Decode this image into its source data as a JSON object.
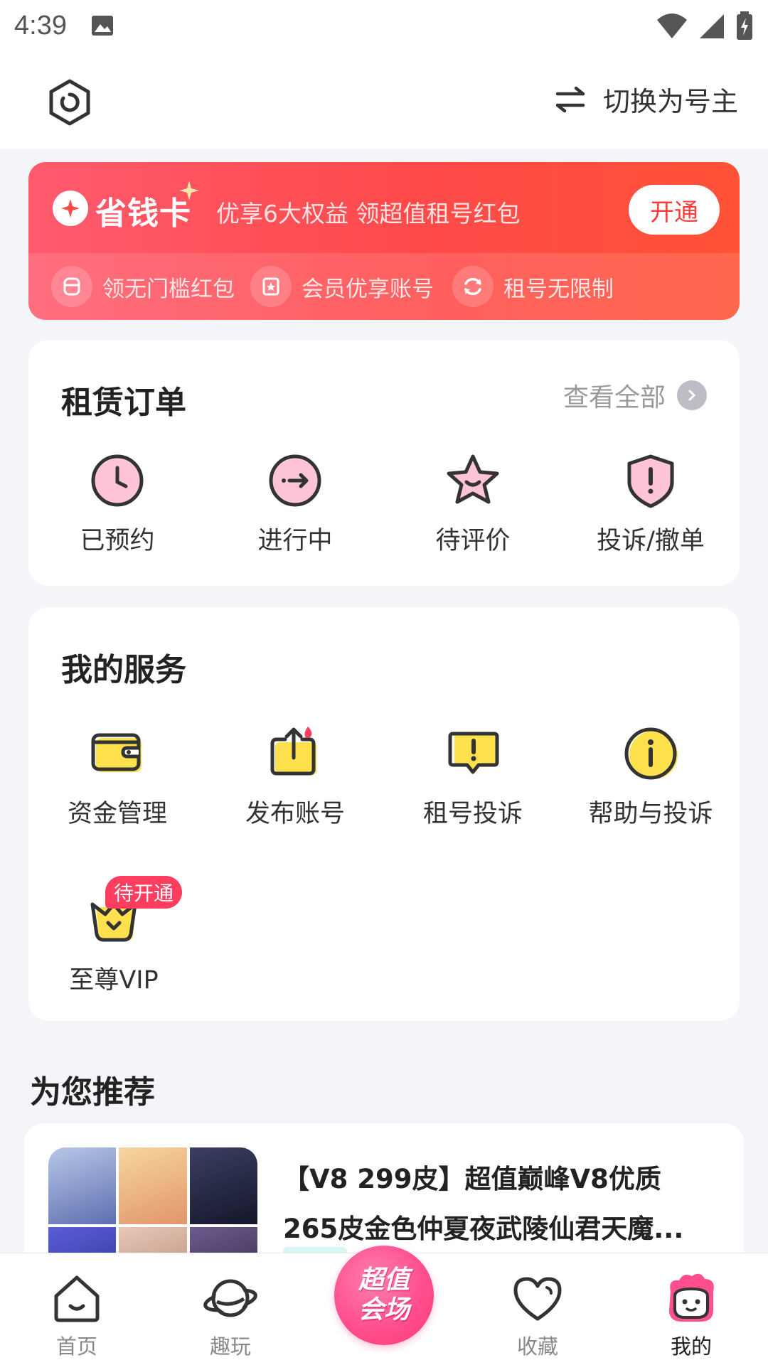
{
  "status": {
    "time": "4:39"
  },
  "header": {
    "switch_label": "切换为号主"
  },
  "promo": {
    "logo_text": "省钱卡",
    "description": "优享6大权益 领超值租号红包",
    "open_button": "开通",
    "perks": [
      "领无门槛红包",
      "会员优享账号",
      "租号无限制"
    ]
  },
  "orders": {
    "title": "租赁订单",
    "view_all": "查看全部",
    "items": [
      {
        "label": "已预约",
        "icon": "clock-icon"
      },
      {
        "label": "进行中",
        "icon": "arrow-circle-icon"
      },
      {
        "label": "待评价",
        "icon": "star-icon"
      },
      {
        "label": "投诉/撤单",
        "icon": "shield-alert-icon"
      }
    ]
  },
  "services": {
    "title": "我的服务",
    "items": [
      {
        "label": "资金管理",
        "icon": "wallet-icon"
      },
      {
        "label": "发布账号",
        "icon": "upload-icon"
      },
      {
        "label": "租号投诉",
        "icon": "complaint-icon"
      },
      {
        "label": "帮助与投诉",
        "icon": "info-icon"
      },
      {
        "label": "至尊VIP",
        "icon": "vip-crown-icon",
        "badge": "待开通"
      }
    ]
  },
  "recommend": {
    "title": "为您推荐",
    "item": {
      "title": "【V8 299皮】超值巅峰V8优质265皮金色仲夏夜武陵仙君天魔..."
    }
  },
  "nav": {
    "items": [
      "首页",
      "趣玩",
      "收藏",
      "我的"
    ],
    "center_line1": "超值",
    "center_line2": "会场",
    "active": "我的"
  },
  "colors": {
    "brand": "#ff4a5c",
    "accent_yellow": "#ffe14d",
    "accent_pink": "#ffc4d8"
  }
}
